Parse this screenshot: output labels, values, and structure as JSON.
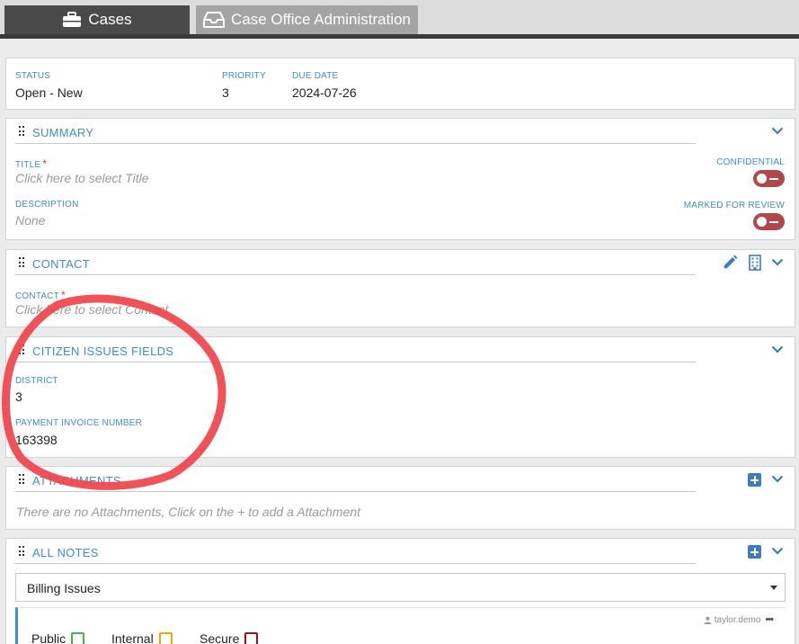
{
  "tabs": [
    {
      "label": "Cases",
      "icon": "briefcase-icon",
      "active": true
    },
    {
      "label": "Case Office Administration",
      "icon": "inbox-tray-icon",
      "active": false
    }
  ],
  "header": {
    "status_label": "STATUS",
    "status_value": "Open - New",
    "priority_label": "PRIORITY",
    "priority_value": "3",
    "due_label": "DUE DATE",
    "due_value": "2024-07-26"
  },
  "summary": {
    "title": "SUMMARY",
    "title_label": "TITLE",
    "title_required": "*",
    "title_placeholder": "Click here to select Title",
    "description_label": "DESCRIPTION",
    "description_value": "None",
    "confidential_label": "CONFIDENTIAL",
    "confidential_on": false,
    "review_label": "MARKED FOR REVIEW",
    "review_on": false
  },
  "contact": {
    "title": "CONTACT",
    "contact_label": "CONTACT",
    "contact_required": "*",
    "contact_placeholder": "Click here to select Contact"
  },
  "citizen": {
    "title": "CITIZEN ISSUES FIELDS",
    "district_label": "DISTRICT",
    "district_value": "3",
    "invoice_label": "PAYMENT INVOICE NUMBER",
    "invoice_value": "163398"
  },
  "attachments": {
    "title": "ATTACHMENTS",
    "empty_text": "There are no Attachments, Click on the + to add a Attachment"
  },
  "notes": {
    "title": "ALL NOTES",
    "category_selected": "Billing Issues",
    "author": "taylor.demo",
    "visibility": [
      {
        "label": "Public",
        "color": "#4caf50"
      },
      {
        "label": "Internal",
        "color": "#f0a800"
      },
      {
        "label": "Secure",
        "color": "#8b1a1a"
      }
    ]
  },
  "colors": {
    "accent": "#3d8fc4",
    "toggle_off": "#b0484c",
    "annotation": "#f0434a"
  }
}
